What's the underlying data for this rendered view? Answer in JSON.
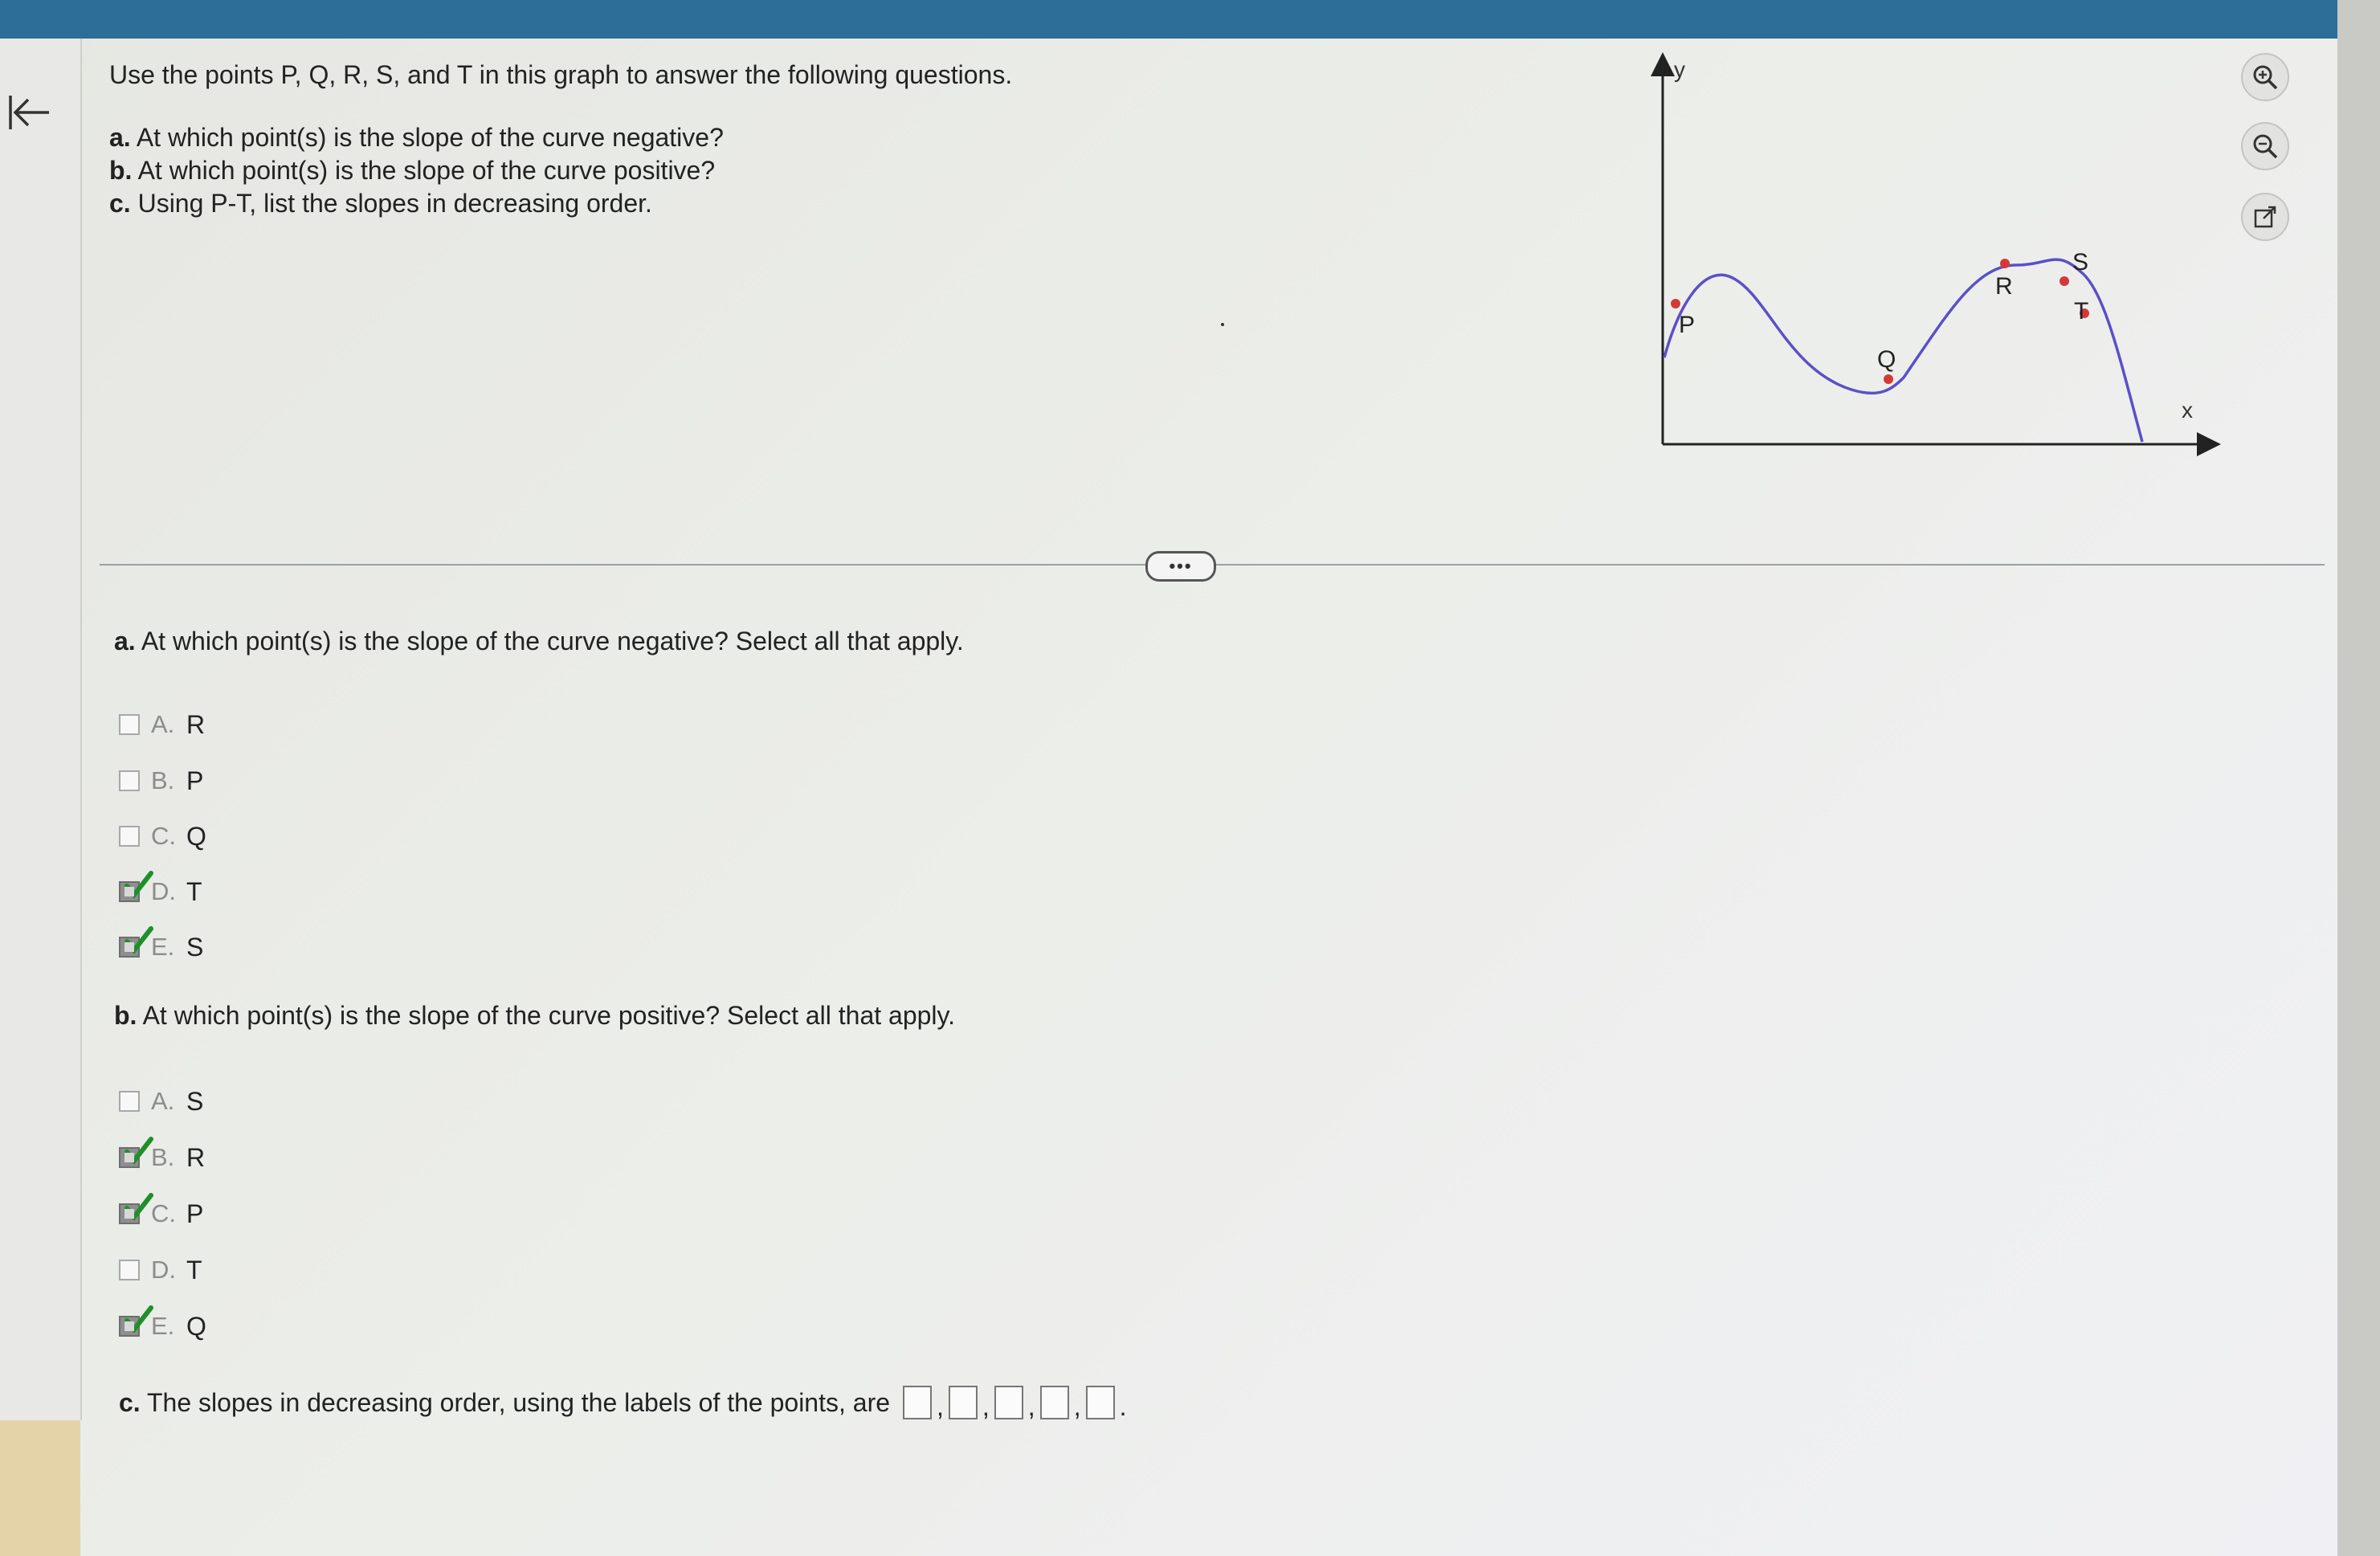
{
  "icons": [
    "back-arrow-icon",
    "zoom-in-icon",
    "zoom-out-icon",
    "popout-icon",
    "checkmark-icon"
  ],
  "colors": {
    "curve": "#5a50c8",
    "point": "#d23a3a",
    "check": "#1f8f2a",
    "header": "#2d6e99"
  },
  "intro": {
    "main": "Use the points P, Q, R, S, and T in this graph to answer the following questions.",
    "a_label": "a.",
    "a_text": " At which point(s) is the slope of the curve negative?",
    "b_label": "b.",
    "b_text": " At which point(s) is the slope of the curve positive?",
    "c_label": "c.",
    "c_text": " Using P-T, list the slopes in decreasing order."
  },
  "graph": {
    "y_label": "y",
    "x_label": "x",
    "points": [
      {
        "label": "P"
      },
      {
        "label": "Q"
      },
      {
        "label": "R"
      },
      {
        "label": "S"
      },
      {
        "label": "T"
      }
    ]
  },
  "divider_handle": "•••",
  "part_a": {
    "label": "a.",
    "question": " At which point(s) is the slope of the curve negative? Select all that apply.",
    "options": [
      {
        "letter": "A.",
        "value": "R",
        "checked": false
      },
      {
        "letter": "B.",
        "value": "P",
        "checked": false
      },
      {
        "letter": "C.",
        "value": "Q",
        "checked": false
      },
      {
        "letter": "D.",
        "value": "T",
        "checked": true
      },
      {
        "letter": "E.",
        "value": "S",
        "checked": true
      }
    ]
  },
  "part_b": {
    "label": "b.",
    "question": " At which point(s) is the slope of the curve positive? Select all that apply.",
    "options": [
      {
        "letter": "A.",
        "value": "S",
        "checked": false
      },
      {
        "letter": "B.",
        "value": "R",
        "checked": true
      },
      {
        "letter": "C.",
        "value": "P",
        "checked": true
      },
      {
        "letter": "D.",
        "value": "T",
        "checked": false
      },
      {
        "letter": "E.",
        "value": "Q",
        "checked": true
      }
    ]
  },
  "part_c": {
    "label": "c.",
    "text": " The slopes in decreasing order, using the labels of the points, are",
    "comma": ",",
    "period": ".",
    "answers": [
      "",
      "",
      "",
      "",
      ""
    ]
  }
}
